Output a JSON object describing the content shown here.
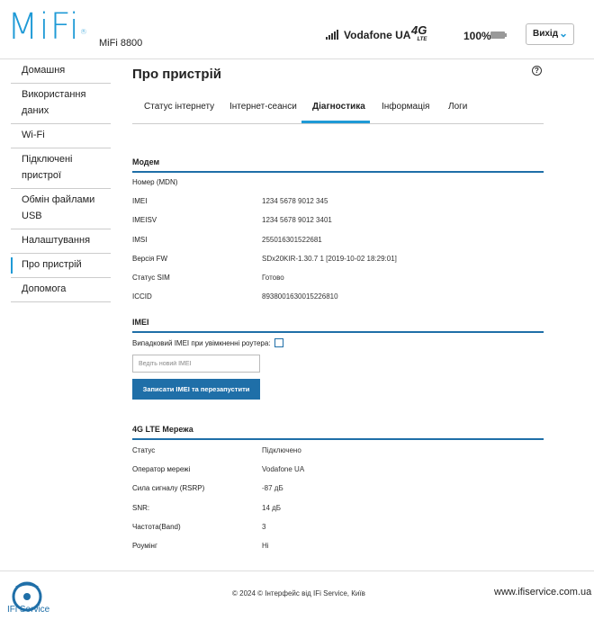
{
  "header": {
    "logo": "MiFi",
    "model": "MiFi 8800",
    "carrier": "Vodafone UA",
    "network_type": "4G",
    "network_sub": "LTE",
    "battery": "100%",
    "logout_label": "Вихід"
  },
  "sidebar": {
    "items": [
      {
        "label": "Домашня"
      },
      {
        "label": "Використання даних"
      },
      {
        "label": "Wi-Fi"
      },
      {
        "label": "Підключені пристрої"
      },
      {
        "label": "Обмін файлами USB"
      },
      {
        "label": "Налаштування"
      },
      {
        "label": "Про пристрій"
      },
      {
        "label": "Допомога"
      }
    ]
  },
  "main": {
    "title": "Про пристрій",
    "help": "?",
    "tabs": [
      {
        "label": "Статус інтернету"
      },
      {
        "label": "Інтернет-сеанси"
      },
      {
        "label": "Діагностика"
      },
      {
        "label": "Інформація"
      },
      {
        "label": "Логи"
      }
    ],
    "modem": {
      "title": "Модем",
      "rows": [
        {
          "label": "Номер (MDN)",
          "value": ""
        },
        {
          "label": "IMEI",
          "value": "1234 5678 9012 345"
        },
        {
          "label": "IMEISV",
          "value": "1234 5678 9012 3401"
        },
        {
          "label": "IMSI",
          "value": "255016301522681"
        },
        {
          "label": "Версія FW",
          "value": "SDx20KIR-1.30.7 1 [2019-10-02 18:29:01]"
        },
        {
          "label": "Статус SIM",
          "value": "Готово"
        },
        {
          "label": "ICCID",
          "value": "8938001630015226810"
        }
      ]
    },
    "imei": {
      "title": "IMEI",
      "random_label": "Випадковий IMEI при увімкненні роутера:",
      "input_placeholder": "Ведіть новий IMEI",
      "button_label": "Записати IMEI та перезапустити"
    },
    "lte": {
      "title": "4G LTE Мережа",
      "rows": [
        {
          "label": "Статус",
          "value": "Підключено"
        },
        {
          "label": "Оператор мережі",
          "value": "Vodafone UA"
        },
        {
          "label": "Сила сигналу (RSRP)",
          "value": "-87 дБ"
        },
        {
          "label": "SNR:",
          "value": "14 дБ"
        },
        {
          "label": "Частота(Band)",
          "value": "3"
        },
        {
          "label": "Роумінг",
          "value": "Ні"
        }
      ]
    }
  },
  "footer": {
    "brand": "IFi Service",
    "copyright": "© 2024 © Інтерфейс від IFi Service, Київ",
    "site": "www.ifiservice.com.ua"
  },
  "colors": {
    "accent": "#1f9ad6",
    "section_line": "#1f6fa8",
    "button": "#1f6fa8"
  }
}
